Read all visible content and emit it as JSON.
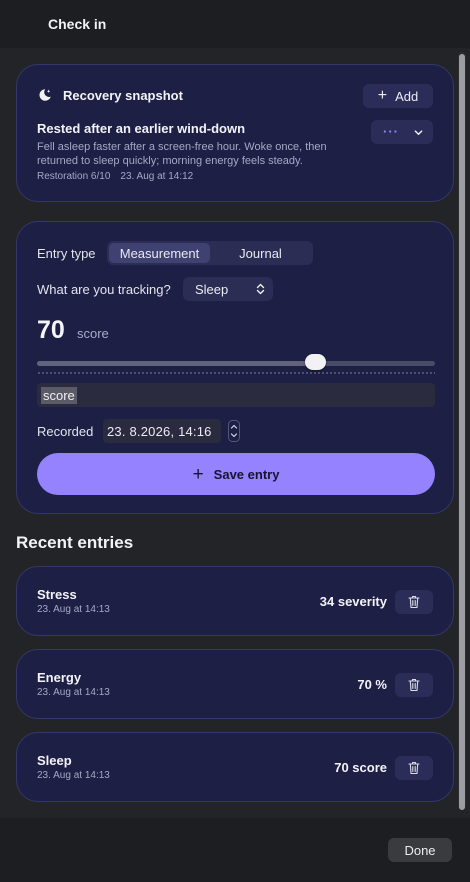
{
  "window": {
    "title": "Check in"
  },
  "snapshot": {
    "title": "Recovery snapshot",
    "add_label": "Add",
    "entry_title": "Rested after an earlier wind-down",
    "entry_description": "Fell asleep faster after a screen-free hour. Woke once, then returned to sleep quickly; morning energy feels steady.",
    "restoration": "Restoration 6/10",
    "timestamp": "23. Aug at 14:12",
    "menu_dots": "···"
  },
  "form": {
    "entry_type_label": "Entry type",
    "entry_types": [
      "Measurement",
      "Journal"
    ],
    "entry_type_selected": "Measurement",
    "tracking_label": "What are you tracking?",
    "tracking_value": "Sleep",
    "value": "70",
    "unit": "score",
    "slider_value": 0.7,
    "unit_field_value": "score",
    "recorded_label": "Recorded",
    "recorded_value": "23.  8.2026, 14:16",
    "save_label": "Save entry"
  },
  "recent": {
    "title": "Recent entries",
    "entries": [
      {
        "name": "Stress",
        "time": "23. Aug at 14:13",
        "value": "34 severity"
      },
      {
        "name": "Energy",
        "time": "23. Aug at 14:13",
        "value": "70 %"
      },
      {
        "name": "Sleep",
        "time": "23. Aug at 14:13",
        "value": "70 score"
      }
    ]
  },
  "footer": {
    "done_label": "Done"
  },
  "colors": {
    "accent": "#9482ff",
    "card_bg": "#1e1f44",
    "card_border": "#35376a",
    "window_bg": "#232427"
  },
  "icons": {
    "snapshot": "moon-stars-icon",
    "add": "plus-icon",
    "menu": "ellipsis-icon",
    "dropdown": "chevron-down-icon",
    "select": "chevron-up-down-icon",
    "save": "plus-icon",
    "delete": "trash-icon"
  }
}
